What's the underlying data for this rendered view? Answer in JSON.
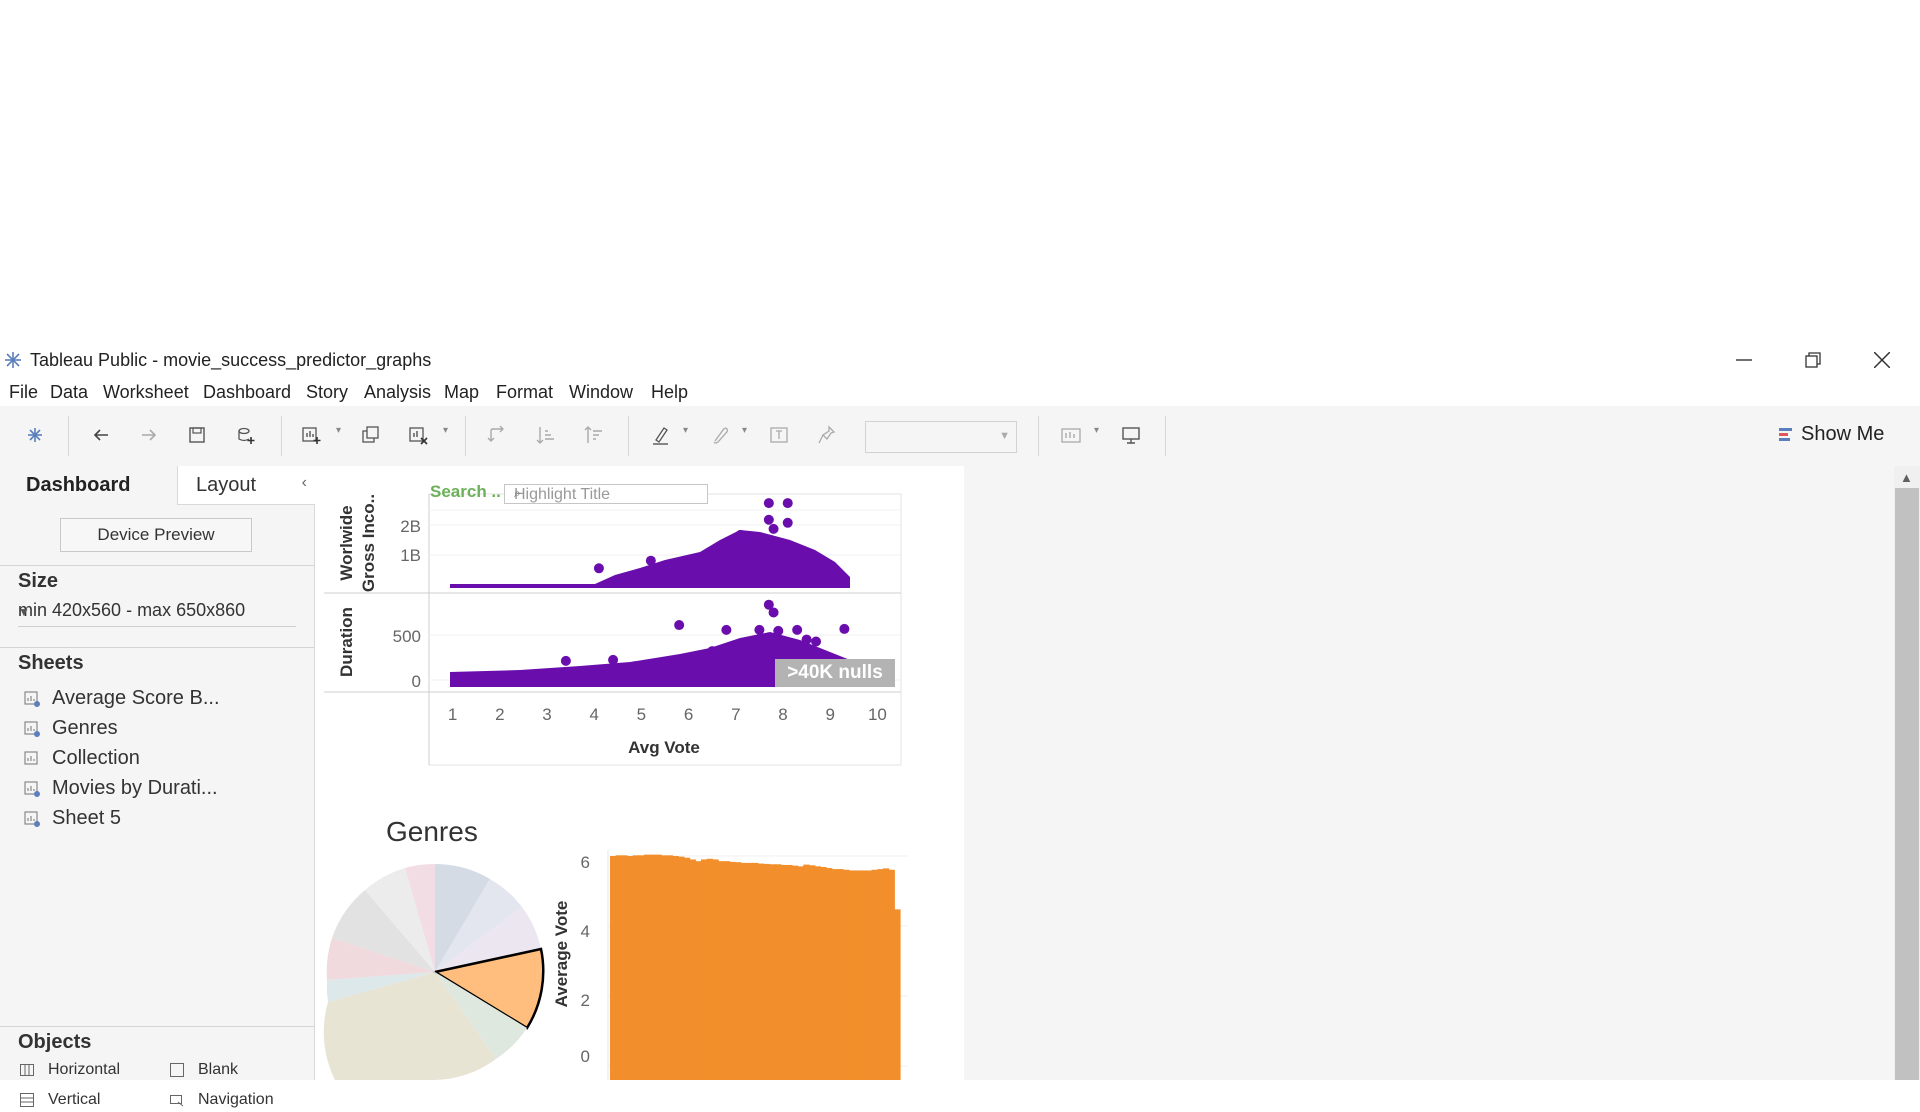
{
  "window": {
    "title": "Tableau Public - movie_success_predictor_graphs"
  },
  "menu": {
    "items": [
      "File",
      "Data",
      "Worksheet",
      "Dashboard",
      "Story",
      "Analysis",
      "Map",
      "Format",
      "Window",
      "Help"
    ]
  },
  "toolbar": {
    "show_me_label": "Show Me"
  },
  "left_panel": {
    "tabs": {
      "dashboard": "Dashboard",
      "layout": "Layout"
    },
    "device_preview_label": "Device Preview",
    "size": {
      "title": "Size",
      "value": "min 420x560 - max 650x860"
    },
    "sheets": {
      "title": "Sheets",
      "items": [
        "Average Score B...",
        "Genres",
        "Collection",
        "Movies by Durati...",
        "Sheet 5"
      ]
    },
    "objects": {
      "title": "Objects",
      "items": [
        "Horizontal",
        "Blank",
        "Vertical",
        "Navigation"
      ]
    }
  },
  "dashboard": {
    "search_label": "Search ..",
    "highlight_placeholder": "Highlight Title",
    "nulls_badge": ">40K nulls",
    "genres_title": "Genres"
  },
  "colors": {
    "purple": "#6a0dad",
    "orange": "#f28e2b",
    "slice_selected": "#ffbe7d",
    "search_green": "#6cb15a"
  },
  "chart_data": [
    {
      "type": "scatter",
      "xlabel": "Avg Vote",
      "x_ticks": [
        "1",
        "2",
        "3",
        "4",
        "5",
        "6",
        "7",
        "8",
        "9",
        "10"
      ],
      "xlim": [
        0.5,
        10.5
      ],
      "panes": [
        {
          "ylabel": "Worlwide Gross Inco..",
          "y_ticks": [
            "2B",
            "1B"
          ],
          "ylim": [
            0,
            3100000000
          ],
          "points": [
            [
              7.7,
              2800000000
            ],
            [
              8.1,
              2800000000
            ],
            [
              7.7,
              2250000000
            ],
            [
              8.1,
              2150000000
            ],
            [
              7.8,
              1950000000
            ],
            [
              7.1,
              1750000000
            ],
            [
              7.0,
              1500000000
            ],
            [
              4.1,
              650000000
            ],
            [
              5.2,
              900000000
            ]
          ]
        },
        {
          "ylabel": "Duration",
          "y_ticks": [
            "500",
            "0"
          ],
          "ylim": [
            -40,
            900
          ],
          "points": [
            [
              7.7,
              810
            ],
            [
              7.8,
              730
            ],
            [
              6.8,
              550
            ],
            [
              5.8,
              600
            ],
            [
              7.5,
              550
            ],
            [
              7.9,
              540
            ],
            [
              8.3,
              550
            ],
            [
              9.3,
              560
            ],
            [
              8.7,
              430
            ],
            [
              8.5,
              450
            ],
            [
              6.5,
              330
            ],
            [
              7.3,
              370
            ],
            [
              8.0,
              360
            ],
            [
              4.4,
              240
            ],
            [
              3.4,
              230
            ]
          ]
        }
      ]
    },
    {
      "type": "pie",
      "title": "Genres"
    },
    {
      "type": "bar",
      "ylabel": "Average Vote",
      "y_ticks": [
        "6",
        "4",
        "2",
        "0"
      ],
      "ylim": [
        0,
        6.1
      ],
      "values": [
        6.1,
        6.12,
        6.12,
        6.1,
        6.12,
        6.12,
        6.14,
        6.14,
        6.14,
        6.12,
        6.12,
        6.1,
        6.08,
        6.05,
        6.0,
        5.95,
        6.0,
        6.02,
        6.0,
        5.95,
        5.95,
        5.93,
        5.92,
        5.9,
        5.9,
        5.9,
        5.88,
        5.87,
        5.86,
        5.86,
        5.84,
        5.84,
        5.82,
        5.8,
        5.85,
        5.83,
        5.8,
        5.78,
        5.75,
        5.72,
        5.72,
        5.7,
        5.68,
        5.68,
        5.68,
        5.68,
        5.7,
        5.72,
        5.74,
        5.7,
        4.55
      ]
    }
  ]
}
